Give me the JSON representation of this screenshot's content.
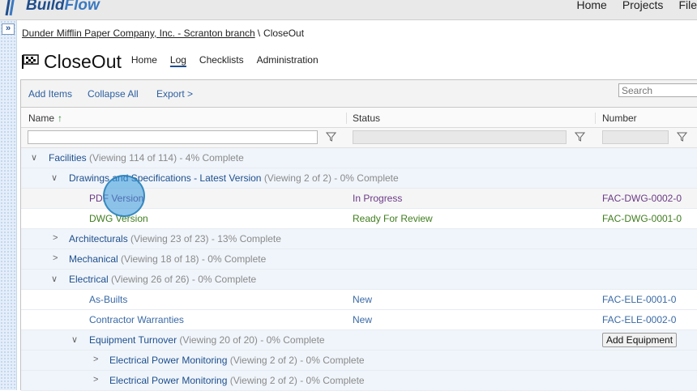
{
  "app": {
    "brand_prefix": "Build",
    "brand_suffix": "Flow",
    "top_nav": [
      "Home",
      "Projects",
      "File"
    ]
  },
  "breadcrumb": {
    "parent": "Dunder Mifflin Paper Company, Inc. - Scranton branch",
    "separator": "\\",
    "current": "CloseOut"
  },
  "module": {
    "title": "CloseOut",
    "tabs": [
      "Home",
      "Log",
      "Checklists",
      "Administration"
    ],
    "active_tab": "Log"
  },
  "toolbar": {
    "add_items": "Add Items",
    "collapse_all": "Collapse All",
    "export": "Export >",
    "search_placeholder": "Search"
  },
  "columns": {
    "name": "Name",
    "name_sort": "↑",
    "status": "Status",
    "number": "Number"
  },
  "rows": [
    {
      "kind": "group",
      "name": "Facilities",
      "meta": "(Viewing 114 of 114) - 4% Complete",
      "expanded": true
    },
    {
      "kind": "group",
      "name": "Drawings and Specifications - Latest Version",
      "meta": "(Viewing 2 of 2) - 0% Complete",
      "expanded": true
    },
    {
      "kind": "item",
      "name": "PDF Version",
      "status": "In Progress",
      "number": "FAC-DWG-0002-0"
    },
    {
      "kind": "item",
      "name": "DWG Version",
      "status": "Ready For Review",
      "number": "FAC-DWG-0001-0"
    },
    {
      "kind": "group",
      "name": "Architecturals",
      "meta": "(Viewing 23 of 23) - 13% Complete",
      "expanded": false
    },
    {
      "kind": "group",
      "name": "Mechanical",
      "meta": "(Viewing 18 of 18) - 0% Complete",
      "expanded": false
    },
    {
      "kind": "group",
      "name": "Electrical",
      "meta": "(Viewing 26 of 26) - 0% Complete",
      "expanded": true
    },
    {
      "kind": "item",
      "name": "As-Builts",
      "status": "New",
      "number": "FAC-ELE-0001-0"
    },
    {
      "kind": "item",
      "name": "Contractor Warranties",
      "status": "New",
      "number": "FAC-ELE-0002-0"
    },
    {
      "kind": "group",
      "name": "Equipment Turnover",
      "meta": "(Viewing 20 of 20) - 0% Complete",
      "expanded": true,
      "action": "Add Equipment"
    },
    {
      "kind": "group",
      "name": "Electrical Power Monitoring",
      "meta": "(Viewing 2 of 2) - 0% Complete",
      "expanded": false
    },
    {
      "kind": "group",
      "name": "Electrical Power Monitoring",
      "meta": "(Viewing 2 of 2) - 0% Complete",
      "expanded": false
    }
  ],
  "colors": {
    "link": "#1e4f8c",
    "in_progress": "#6b3a86",
    "ready_for_review": "#3f7d1e",
    "new": "#3a6aa6",
    "meta": "#8a8a8a",
    "sort_arrow": "#2f8a2f"
  },
  "icons": {
    "rail_toggle": "double-chevron-right-icon",
    "module": "flag-icon",
    "filter": "funnel-icon",
    "expanded": "chevron-down-icon",
    "collapsed": "chevron-right-icon"
  }
}
